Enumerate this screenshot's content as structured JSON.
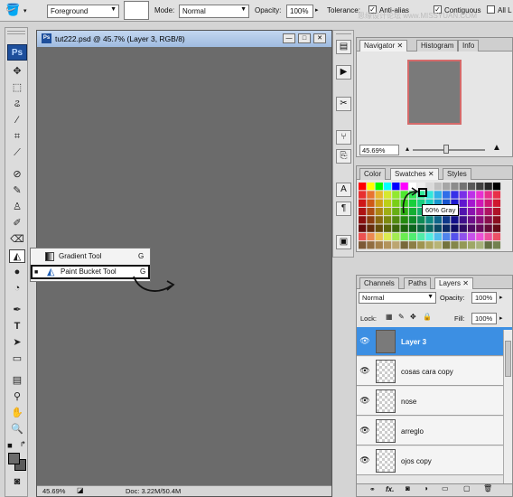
{
  "options_bar": {
    "fill_source": "Foreground",
    "mode_label": "Mode:",
    "mode_value": "Normal",
    "opacity_label": "Opacity:",
    "opacity_value": "100%",
    "tolerance_label": "Tolerance:",
    "antialias_label": "Anti-alias",
    "contiguous_label": "Contiguous",
    "all_layers_label": "All L",
    "watermark": "思缘设计论坛 www.MISSYUAN.COM"
  },
  "toolbox": {
    "logo": "Ps",
    "tools": [
      "move-tool",
      "marquee-tool",
      "lasso-tool",
      "magic-wand-tool",
      "crop-tool",
      "slice-tool",
      "healing-brush-tool",
      "brush-tool",
      "clone-stamp-tool",
      "history-brush-tool",
      "eraser-tool",
      "paint-bucket-tool",
      "blur-tool",
      "dodge-tool",
      "pen-tool",
      "type-tool",
      "path-selection-tool",
      "rectangle-tool",
      "notes-tool",
      "eyedropper-tool",
      "hand-tool",
      "zoom-tool"
    ]
  },
  "flyout": {
    "items": [
      {
        "label": "Gradient Tool",
        "key": "G"
      },
      {
        "label": "Paint Bucket Tool",
        "key": "G"
      }
    ]
  },
  "document": {
    "title": "tut222.psd @ 45.7% (Layer 3, RGB/8)",
    "zoom": "45.69%",
    "doc_info": "Doc: 3.22M/50.4M",
    "bg_color": "#6b6b6b"
  },
  "navigator": {
    "tabs": [
      "Navigator",
      "Histogram",
      "Info"
    ],
    "zoom": "45.69%"
  },
  "swatches": {
    "tabs": [
      "Color",
      "Swatches",
      "Styles"
    ],
    "tooltip": "60% Gray"
  },
  "layers": {
    "tabs": [
      "Channels",
      "Paths",
      "Layers"
    ],
    "blend_mode": "Normal",
    "opacity_label": "Opacity:",
    "opacity_value": "100%",
    "lock_label": "Lock:",
    "fill_label": "Fill:",
    "fill_value": "100%",
    "items": [
      {
        "name": "Layer 3",
        "selected": true
      },
      {
        "name": "cosas cara copy",
        "selected": false
      },
      {
        "name": "nose",
        "selected": false
      },
      {
        "name": "arreglo",
        "selected": false
      },
      {
        "name": "ojos copy",
        "selected": false
      }
    ],
    "footer_fx": "fx."
  },
  "colors": {
    "selection_blue": "#3c8fe3",
    "highlight_red": "#d56a6a",
    "ps_blue": "#1e4f9c"
  }
}
